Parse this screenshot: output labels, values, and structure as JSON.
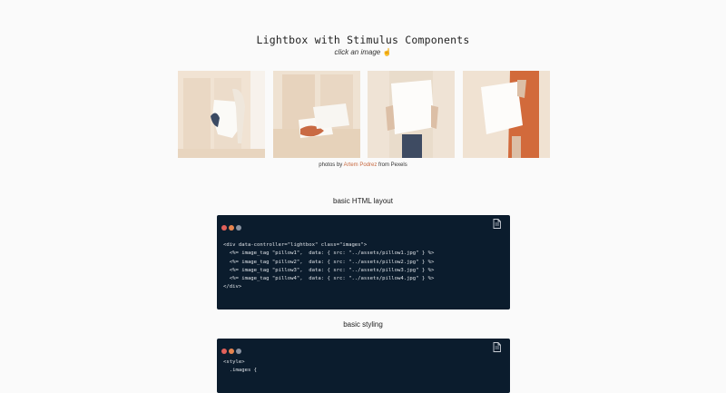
{
  "page": {
    "title": "Lightbox with Stimulus Components",
    "subtitle": "click an image",
    "subtitle_icon": "☝"
  },
  "gallery": {
    "photos": [
      {
        "name": "pillow1"
      },
      {
        "name": "pillow2"
      },
      {
        "name": "pillow3"
      },
      {
        "name": "pillow4"
      }
    ]
  },
  "credit": {
    "prefix": "photos by",
    "author": "Artem Podrez",
    "suffix": "from Pexels",
    "link_color": "#c7683f"
  },
  "sections": [
    {
      "title": "basic HTML layout",
      "code": [
        "<div data-controller=\"lightbox\" class=\"images\">",
        "  <%= image_tag \"pillow1\",  data: { src: \"../assets/pillow1.jpg\" } %>",
        "  <%= image_tag \"pillow2\",  data: { src: \"../assets/pillow2.jpg\" } %>",
        "  <%= image_tag \"pillow3\",  data: { src: \"../assets/pillow3.jpg\" } %>",
        "  <%= image_tag \"pillow4\",  data: { src: \"../assets/pillow4.jpg\" } %>",
        "</div>"
      ]
    },
    {
      "title": "basic styling",
      "code": [
        "<style>",
        "  .images {"
      ]
    }
  ],
  "colors": {
    "code_background": "#0b1c2d",
    "dot_red": "#e1605a",
    "dot_orange": "#e5844f",
    "dot_gray": "#8891a0"
  }
}
